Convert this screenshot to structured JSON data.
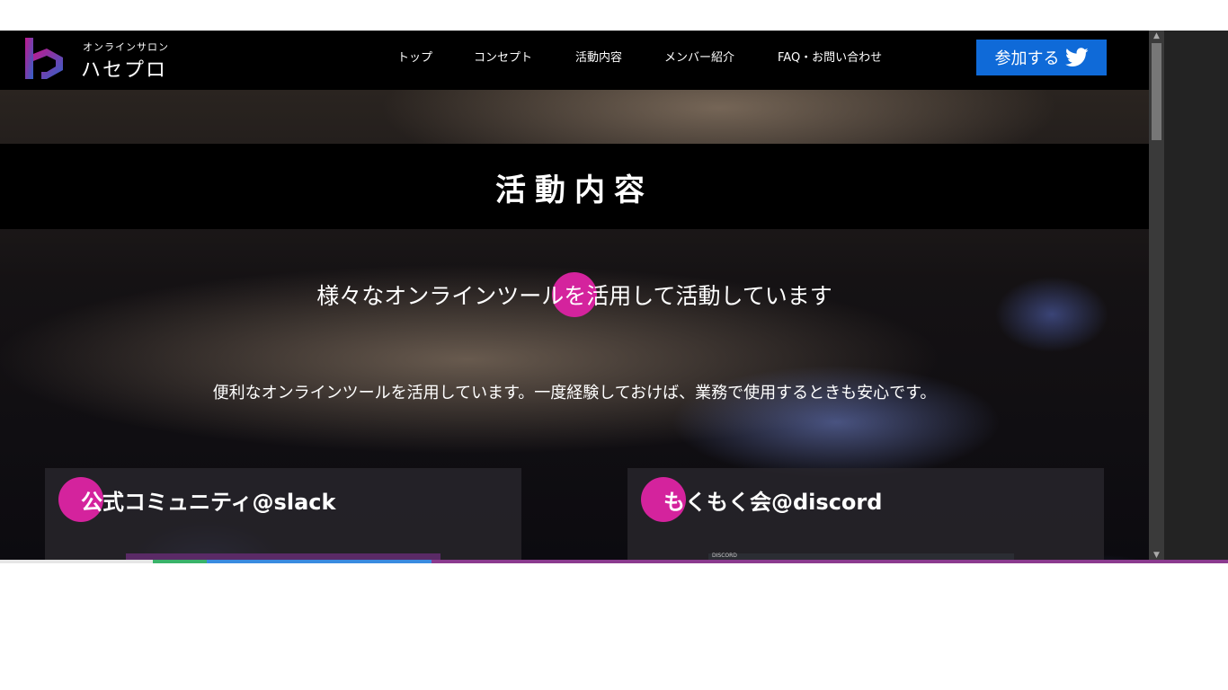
{
  "brand": {
    "subtitle": "オンラインサロン",
    "name": "ハセプロ",
    "logo_icon": "hasepro-logo-icon"
  },
  "nav": {
    "items": [
      {
        "label": "トップ"
      },
      {
        "label": "コンセプト"
      },
      {
        "label": "活動内容"
      },
      {
        "label": "メンバー紹介"
      },
      {
        "label": "FAQ・お問い合わせ"
      }
    ]
  },
  "join_button": {
    "label": "参加する",
    "icon": "twitter-icon",
    "color": "#0f6ad8"
  },
  "page": {
    "title": "活動内容",
    "heading": "様々なオンラインツールを活用して活動しています",
    "body": "便利なオンラインツールを活用しています。一度経験しておけば、業務で使用するときも安心です。"
  },
  "cards": [
    {
      "title": "公式コミュニティ@slack"
    },
    {
      "title": "もくもく会@discord",
      "thumb_label": "DISCORD"
    }
  ],
  "colors": {
    "accent": "#d4239d",
    "header_bg": "#000000"
  }
}
